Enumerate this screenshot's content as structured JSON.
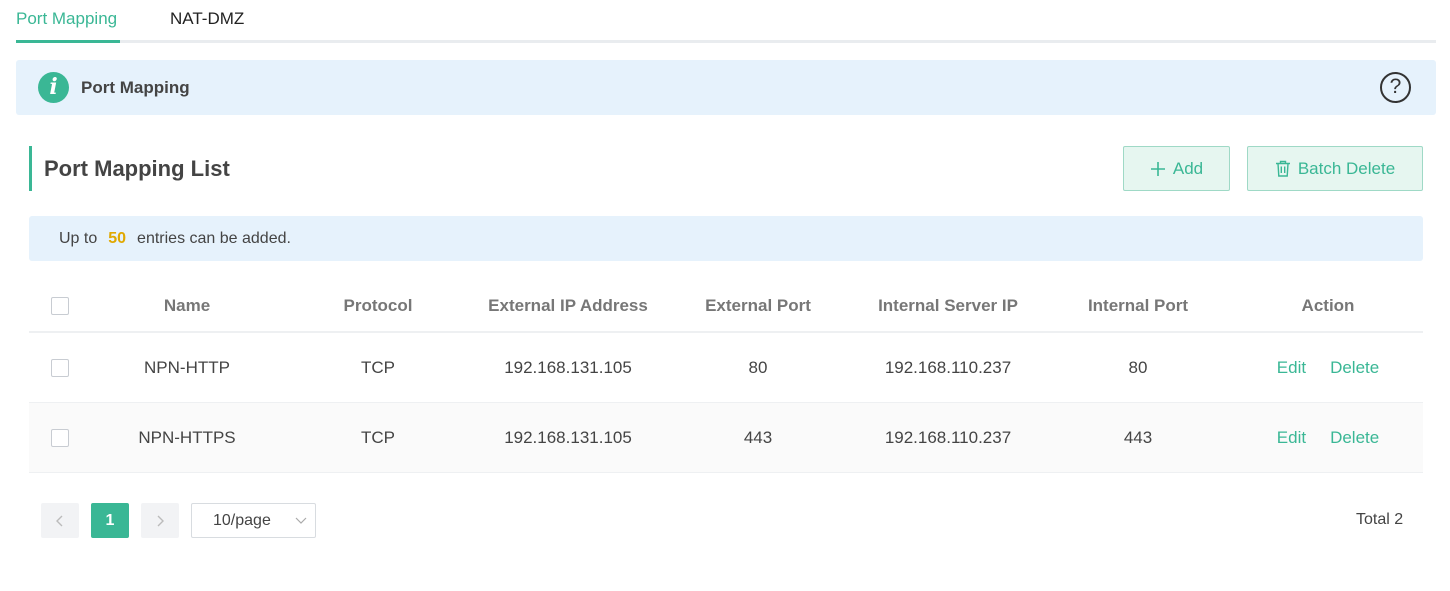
{
  "tabs": [
    {
      "label": "Port Mapping",
      "active": true
    },
    {
      "label": "NAT-DMZ",
      "active": false
    }
  ],
  "info_banner": {
    "title": "Port Mapping",
    "icon": "info-icon",
    "help_icon": "question-icon"
  },
  "section": {
    "title": "Port Mapping List"
  },
  "buttons": {
    "add_label": "Add",
    "batch_delete_label": "Batch Delete"
  },
  "notice": {
    "prefix": "Up to",
    "max_entries": "50",
    "suffix": "entries can be added."
  },
  "table": {
    "columns": [
      "Name",
      "Protocol",
      "External IP Address",
      "External Port",
      "Internal Server IP",
      "Internal Port",
      "Action"
    ],
    "rows": [
      {
        "name": "NPN-HTTP",
        "protocol": "TCP",
        "external_ip": "192.168.131.105",
        "external_port": "80",
        "internal_ip": "192.168.110.237",
        "internal_port": "80",
        "edit": "Edit",
        "delete": "Delete"
      },
      {
        "name": "NPN-HTTPS",
        "protocol": "TCP",
        "external_ip": "192.168.131.105",
        "external_port": "443",
        "internal_ip": "192.168.110.237",
        "internal_port": "443",
        "edit": "Edit",
        "delete": "Delete"
      }
    ]
  },
  "pagination": {
    "current_page": "1",
    "page_size": "10/page",
    "total": "Total 2"
  },
  "colors": {
    "accent": "#3ab795",
    "highlight": "#e0a800",
    "info_bg": "#e6f2fc"
  }
}
